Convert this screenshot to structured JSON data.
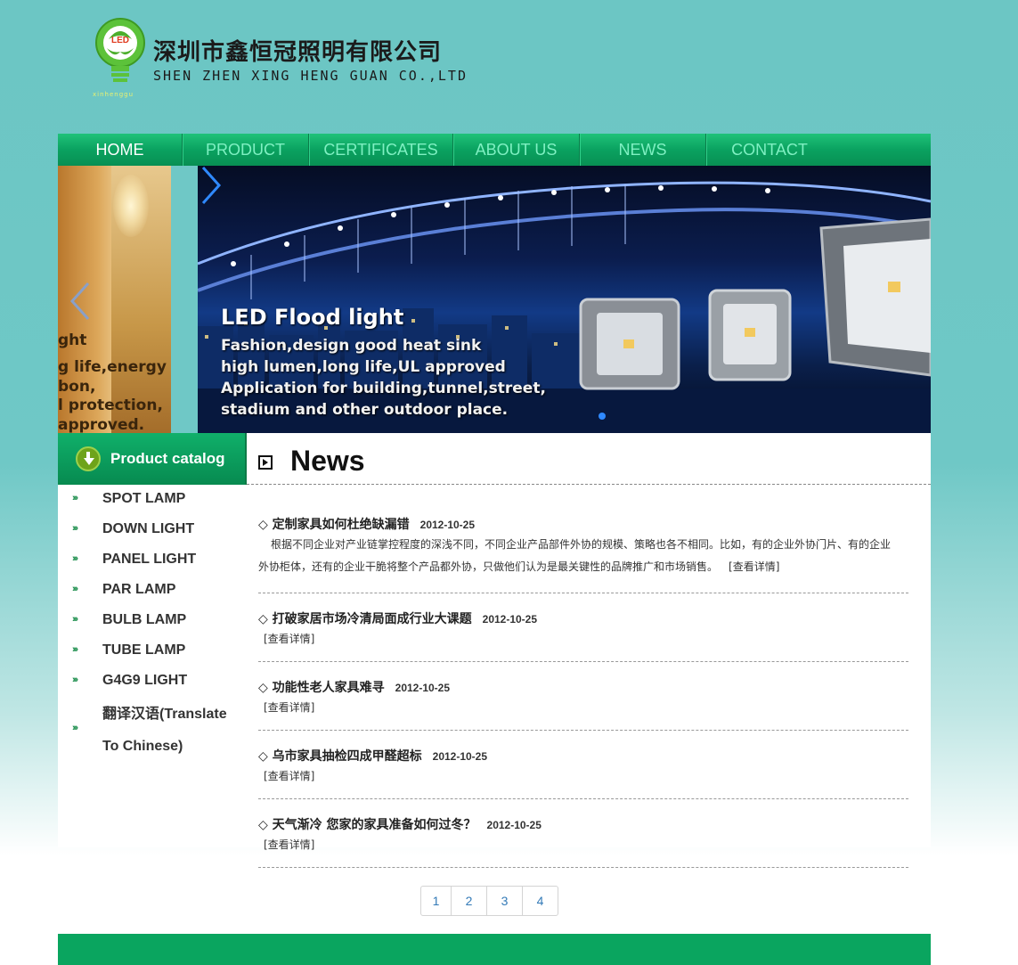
{
  "header": {
    "logo_badge": "LED",
    "company_cn": "深圳市鑫恒冠照明有限公司",
    "company_en": "SHEN ZHEN XING HENG GUAN CO.,LTD",
    "tagline": "xinhenggu"
  },
  "nav": {
    "items": [
      {
        "label": "HOME",
        "active": true
      },
      {
        "label": "PRODUCT",
        "active": false
      },
      {
        "label": "CERTIFICATES",
        "active": false
      },
      {
        "label": "ABOUT US",
        "active": false
      },
      {
        "label": "NEWS",
        "active": false
      },
      {
        "label": "CONTACT",
        "active": false
      }
    ]
  },
  "banner": {
    "left_lines": [
      "ght",
      "g life,energy",
      "bon,",
      "l protection,",
      "approved."
    ],
    "title": "LED Flood light",
    "lines": [
      "Fashion,design good heat sink",
      "high lumen,long life,UL approved",
      "Application for building,tunnel,street,",
      "stadium and other outdoor place."
    ],
    "colors": {
      "dot": "#2f89ff",
      "arrow": "#2f89ff"
    }
  },
  "catalog": {
    "title": "Product catalog",
    "bullet": "›››",
    "items": [
      "SPOT LAMP",
      "DOWN LIGHT",
      "PANEL LIGHT",
      "PAR LAMP",
      "BULB LAMP",
      "TUBE LAMP",
      "G4G9 LIGHT",
      "翻译汉语(Translate To Chinese)"
    ]
  },
  "news": {
    "title": "News",
    "items": [
      {
        "title": "◇ 定制家具如何杜绝缺漏错",
        "date": "2012-10-25",
        "desc": "根据不同企业对产业链掌控程度的深浅不同，不同企业产品部件外协的规模、策略也各不相同。比如，有的企业外协门片、有的企业外协柜体，还有的企业干脆将整个产品都外协，只做他们认为是最关键性的品牌推广和市场销售。",
        "more": "[查看详情]"
      },
      {
        "title": "◇ 打破家居市场冷清局面成行业大课题",
        "date": "2012-10-25",
        "more": "[查看详情]"
      },
      {
        "title": "◇ 功能性老人家具难寻",
        "date": "2012-10-25",
        "more": "[查看详情]"
      },
      {
        "title": "◇ 乌市家具抽检四成甲醛超标",
        "date": "2012-10-25",
        "more": "[查看详情]"
      },
      {
        "title": "◇ 天气渐冷 您家的家具准备如何过冬？",
        "date": "2012-10-25",
        "more": "[查看详情]"
      }
    ]
  },
  "pagination": {
    "pages": [
      "1",
      "2",
      "3",
      "4"
    ]
  },
  "colors": {
    "brand_green": "#0aa55f",
    "background_teal": "#6cc6c4",
    "link_blue": "#337ab7"
  }
}
